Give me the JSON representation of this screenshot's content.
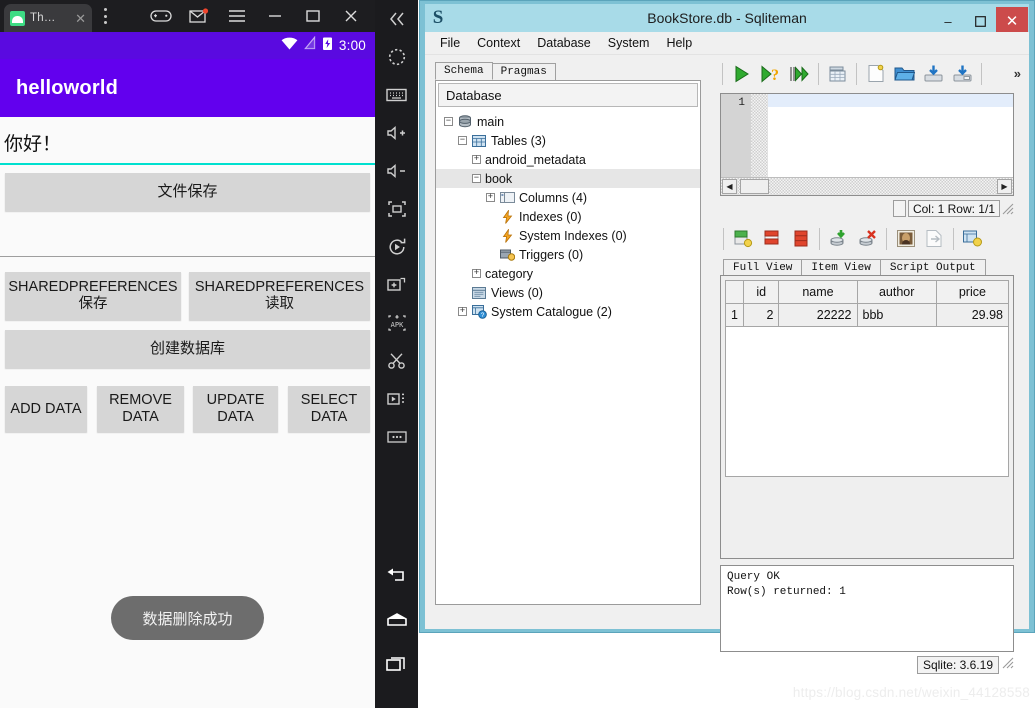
{
  "emulator": {
    "tab": {
      "label": "Th…",
      "icon": "android-icon",
      "close": "✕"
    },
    "overflow_menu": "kebab-menu-icon",
    "window_buttons": [
      "gamepad-icon",
      "message-icon",
      "hamburger-icon",
      "minimize",
      "maximize",
      "close"
    ],
    "status_bar": {
      "time": "3:00",
      "wifi": "wifi-icon",
      "signal": "signal-icon",
      "battery": "battery-charging-icon"
    },
    "app_bar": {
      "title": "helloworld"
    },
    "app": {
      "edit_text_value": "你好！",
      "buttons": {
        "file_save": "文件保存",
        "sp_save": "SHAREDPREFERENCES\n保存",
        "sp_save_line1": "SHAREDPREFERENCES",
        "sp_save_line2": "保存",
        "sp_read_line1": "SHAREDPREFERENCES",
        "sp_read_line2": "读取",
        "create_db": "创建数据库",
        "add_data_l1": "ADD DATA",
        "remove_data_l1": "REMOVE",
        "remove_data_l2": "DATA",
        "update_data_l1": "UPDATE",
        "update_data_l2": "DATA",
        "select_data_l1": "SELECT",
        "select_data_l2": "DATA"
      },
      "toast": "数据删除成功"
    },
    "sidebar_icons": [
      "collapse-left-icon",
      "power-icon",
      "keyboard-icon",
      "volume-up-icon",
      "volume-down-icon",
      "rotate-frame-icon",
      "rotate-icon",
      "screenshot-icon",
      "apk-install-icon",
      "scissors-icon",
      "record-icon",
      "more-icon"
    ],
    "nav_icons": [
      "back-icon",
      "home-icon",
      "recents-icon"
    ],
    "colors": {
      "app_bar": "#6200ee",
      "status_bar": "#5a0ae0",
      "accent": "#00e0cf",
      "button": "#d6d6d6"
    }
  },
  "sqliteman": {
    "title": "BookStore.db - Sqliteman",
    "logo": "S",
    "window_buttons": {
      "minimize": "–",
      "maximize": "▫",
      "close": "✕"
    },
    "menu": [
      "File",
      "Context",
      "Database",
      "System",
      "Help"
    ],
    "schema_tabs": [
      {
        "label": "Schema",
        "active": true
      },
      {
        "label": "Pragmas",
        "active": false
      }
    ],
    "tree_header": "Database",
    "tree": [
      {
        "label": "main",
        "depth": 0,
        "expander": "−",
        "icon": "database-icon",
        "selected": false
      },
      {
        "label": "Tables (3)",
        "depth": 1,
        "expander": "−",
        "icon": "table-icon",
        "selected": false
      },
      {
        "label": "android_metadata",
        "depth": 2,
        "expander": "+",
        "icon": "none",
        "selected": false
      },
      {
        "label": "book",
        "depth": 2,
        "expander": "−",
        "icon": "none",
        "selected": true
      },
      {
        "label": "Columns (4)",
        "depth": 3,
        "expander": "+",
        "icon": "column-icon",
        "selected": false
      },
      {
        "label": "Indexes (0)",
        "depth": 3,
        "expander": "none",
        "icon": "index-icon",
        "selected": false
      },
      {
        "label": "System Indexes (0)",
        "depth": 3,
        "expander": "none",
        "icon": "index-icon",
        "selected": false
      },
      {
        "label": "Triggers (0)",
        "depth": 3,
        "expander": "none",
        "icon": "trigger-icon",
        "selected": false
      },
      {
        "label": "category",
        "depth": 2,
        "expander": "+",
        "icon": "none",
        "selected": false
      },
      {
        "label": "Views (0)",
        "depth": 1,
        "expander": "none",
        "icon": "view-icon",
        "selected": false
      },
      {
        "label": "System Catalogue (2)",
        "depth": 1,
        "expander": "+",
        "icon": "catalogue-icon",
        "selected": false
      }
    ],
    "toolbar_top": [
      "run-sql-icon",
      "run-explain-icon",
      "run-step-icon",
      "create-table-icon",
      "new-document-icon",
      "open-folder-icon",
      "import-db-icon",
      "export-db-icon"
    ],
    "toolbar_top_overflow": "»",
    "toolbar_bottom": [
      "insert-row-icon",
      "delete-row-icon",
      "truncate-table-icon",
      "commit-icon",
      "rollback-icon",
      "blob-preview-icon",
      "export-data-icon",
      "describe-table-icon"
    ],
    "editor": {
      "line_number": "1",
      "content": ""
    },
    "editor_status": "Col: 1 Row: 1/1",
    "view_tabs": [
      {
        "label": "Full View",
        "active": true
      },
      {
        "label": "Item View",
        "active": false
      },
      {
        "label": "Script Output",
        "active": false
      }
    ],
    "result_table": {
      "columns": [
        "id",
        "name",
        "author",
        "price"
      ],
      "rows": [
        {
          "num": "1",
          "id": "2",
          "name": "22222",
          "author": "bbb",
          "price": "29.98"
        }
      ]
    },
    "output_lines": [
      "Query OK",
      "Row(s) returned: 1"
    ],
    "status_bar": "Sqlite: 3.6.19",
    "colors": {
      "title_bar": "#a8dbe8",
      "frame": "#7dc1d4",
      "close_button": "#cc4b4b"
    }
  },
  "watermark": "https://blog.csdn.net/weixin_44128558"
}
